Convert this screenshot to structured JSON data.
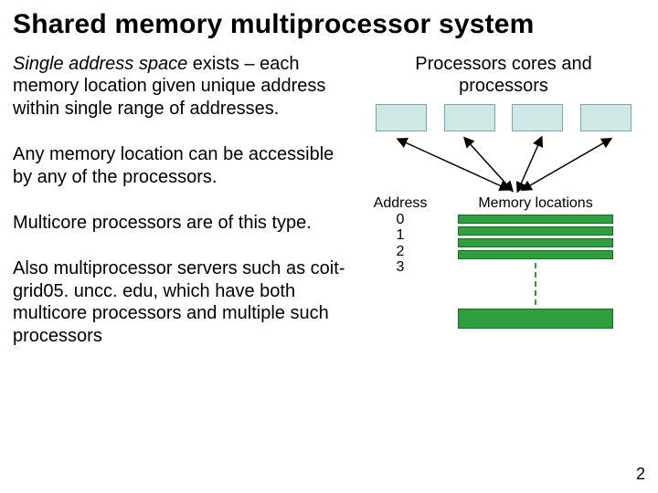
{
  "title": "Shared memory multiprocessor system",
  "left": {
    "p1_emph": "Single address space",
    "p1_rest": " exists – each memory location given unique address within single range of addresses.",
    "p2": "Any memory location can be accessible by any of the processors.",
    "p3": "Multicore processors are of this type.",
    "p4": "Also multiprocessor servers such as coit-grid05. uncc. edu, which have both multicore processors and multiple such processors"
  },
  "right": {
    "proc_label": "Processors cores and processors",
    "address_label": "Address",
    "addresses": {
      "a0": "0",
      "a1": "1",
      "a2": "2",
      "a3": "3"
    },
    "mem_label": "Memory locations"
  },
  "page_number": "2"
}
